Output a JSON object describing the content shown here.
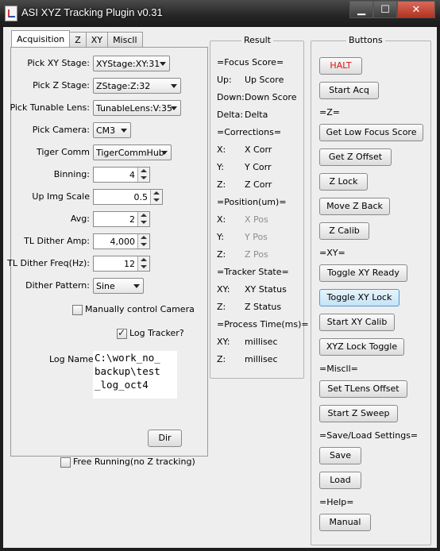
{
  "window": {
    "title": "ASI XYZ Tracking Plugin v0.31",
    "minimize": "▁",
    "maximize": "☐",
    "close": "✕"
  },
  "tabs": [
    "Acquisition",
    "Z",
    "XY",
    "Miscll"
  ],
  "acquisition": {
    "xy_stage_label": "Pick XY Stage:",
    "xy_stage_value": "XYStage:XY:31",
    "z_stage_label": "Pick Z Stage:",
    "z_stage_value": "ZStage:Z:32",
    "tunable_lens_label": "Pick Tunable Lens:",
    "tunable_lens_value": "TunableLens:V:35",
    "camera_label": "Pick Camera:",
    "camera_value": "CM3",
    "tiger_comm_label": "Tiger Comm",
    "tiger_comm_value": "TigerCommHub",
    "binning_label": "Binning:",
    "binning_value": "4",
    "up_img_scale_label": "Up Img Scale",
    "up_img_scale_value": "0.5",
    "avg_label": "Avg:",
    "avg_value": "2",
    "tl_dither_amp_label": "TL Dither Amp:",
    "tl_dither_amp_value": "4,000",
    "tl_dither_freq_label": "TL Dither Freq(Hz):",
    "tl_dither_freq_value": "12",
    "dither_pattern_label": "Dither Pattern:",
    "dither_pattern_value": "Sine",
    "manual_camera_label": "Manually control Camera",
    "manual_camera_checked": false,
    "log_tracker_label": "Log Tracker?",
    "log_tracker_checked": true,
    "log_name_label": "Log Name:",
    "log_name_lines": [
      "C:\\work_no_",
      "backup\\test",
      "_log_oct4"
    ],
    "dir_button": "Dir",
    "free_running_label": "Free Running(no Z tracking)",
    "free_running_checked": false
  },
  "result": {
    "title": "Result",
    "focus_score_header": "=Focus Score=",
    "up_label": "Up:",
    "up_value": "Up Score",
    "down_label": "Down:",
    "down_value": "Down Score",
    "delta_label": "Delta:",
    "delta_value": "Delta",
    "corrections_header": "=Corrections=",
    "x_label": "X:",
    "x_corr": "X Corr",
    "y_label": "Y:",
    "y_corr": "Y Corr",
    "z_label": "Z:",
    "z_corr": "Z Corr",
    "position_header": "=Position(um)=",
    "x_pos": "X Pos",
    "y_pos": "Y Pos",
    "z_pos": "Z Pos",
    "tracker_state_header": "=Tracker State=",
    "xy_label": "XY:",
    "xy_status": "XY Status",
    "z_status": "Z Status",
    "process_time_header": "=Process Time(ms)=",
    "xy_time": "millisec",
    "z_time": "millisec"
  },
  "buttons": {
    "title": "Buttons",
    "halt": "HALT",
    "start_acq": "Start Acq",
    "z_header": "=Z=",
    "get_low_focus": "Get Low Focus Score",
    "get_z_offset": "Get Z Offset",
    "z_lock": "Z Lock",
    "move_z_back": "Move Z Back",
    "z_calib": "Z Calib",
    "xy_header": "=XY=",
    "toggle_xy_ready": "Toggle XY Ready",
    "toggle_xy_lock": "Toggle XY Lock",
    "start_xy_calib": "Start XY Calib",
    "xyz_lock_toggle": "XYZ Lock Toggle",
    "miscll_header": "=Miscll=",
    "set_tlens_offset": "Set TLens Offset",
    "start_z_sweep": "Start Z Sweep",
    "save_load_header": "=Save/Load Settings=",
    "save": "Save",
    "load": "Load",
    "help_header": "=Help=",
    "manual": "Manual"
  },
  "colors": {
    "halt_text": "#e01010",
    "disabled_text": "#8c8c8c",
    "highlight_button": "#c5e3f5"
  }
}
